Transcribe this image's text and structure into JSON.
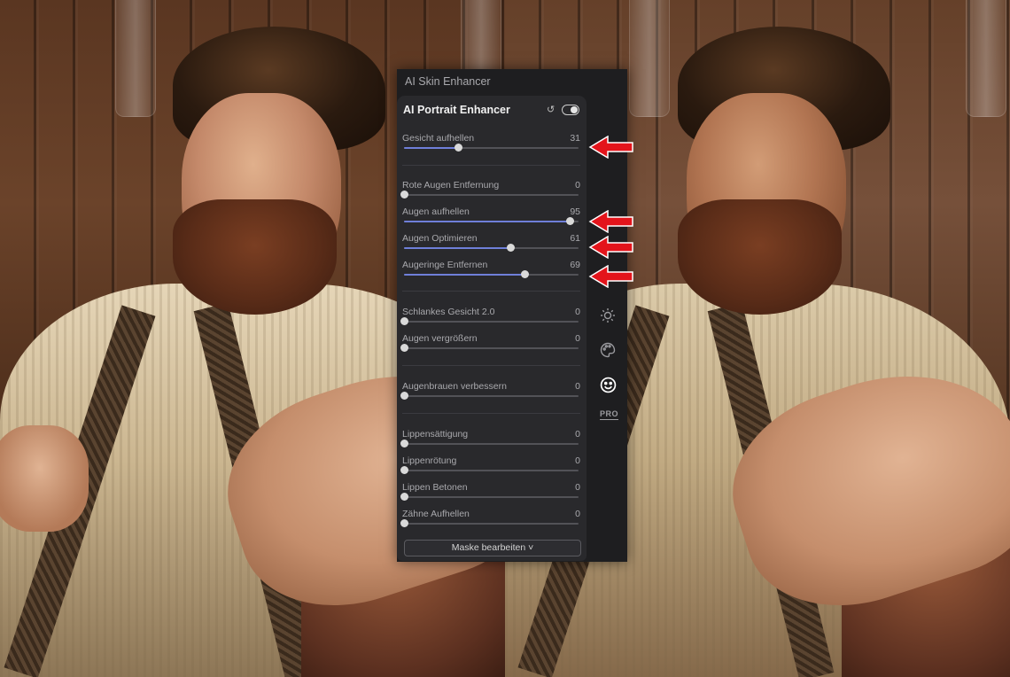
{
  "panel": {
    "title": "AI Skin Enhancer",
    "card_title": "AI Portrait Enhancer",
    "mask_button": "Maske bearbeiten ˅"
  },
  "sliders": [
    {
      "label": "Gesicht aufhellen",
      "value": "31",
      "fraction": 0.31
    },
    {
      "label": "Rote Augen Entfernung",
      "value": "0",
      "fraction": 0
    },
    {
      "label": "Augen aufhellen",
      "value": "95",
      "fraction": 0.95
    },
    {
      "label": "Augen Optimieren",
      "value": "61",
      "fraction": 0.61
    },
    {
      "label": "Augeringe Entfernen",
      "value": "69",
      "fraction": 0.69
    },
    {
      "label": "Schlankes Gesicht 2.0",
      "value": "0",
      "fraction": 0
    },
    {
      "label": "Augen vergrößern",
      "value": "0",
      "fraction": 0
    },
    {
      "label": "Augenbrauen verbessern",
      "value": "0",
      "fraction": 0
    },
    {
      "label": "Lippensättigung",
      "value": "0",
      "fraction": 0
    },
    {
      "label": "Lippenrötung",
      "value": "0",
      "fraction": 0
    },
    {
      "label": "Lippen Betonen",
      "value": "0",
      "fraction": 0
    },
    {
      "label": "Zähne Aufhellen",
      "value": "0",
      "fraction": 0
    }
  ],
  "rail": {
    "icons": [
      "sun-icon",
      "palette-icon",
      "smiley-face-icon"
    ],
    "active": "smiley-face-icon",
    "pro_label": "PRO"
  },
  "colors": {
    "slider_fill": "#6f7fd9",
    "annotation_arrow": "#e3141b"
  }
}
